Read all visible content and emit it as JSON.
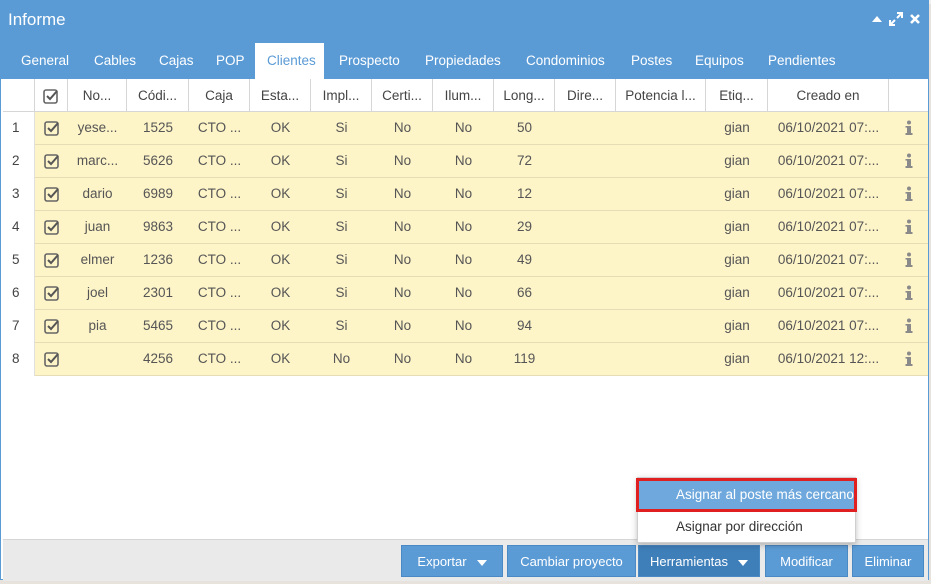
{
  "window": {
    "title": "Informe"
  },
  "tabs": [
    {
      "label": "General",
      "active": false
    },
    {
      "label": "Cables",
      "active": false
    },
    {
      "label": "Cajas",
      "active": false
    },
    {
      "label": "POP",
      "active": false
    },
    {
      "label": "Clientes",
      "active": true
    },
    {
      "label": "Prospecto",
      "active": false
    },
    {
      "label": "Propiedades",
      "active": false
    },
    {
      "label": "Condominios",
      "active": false
    },
    {
      "label": "Postes",
      "active": false
    },
    {
      "label": "Equipos",
      "active": false
    },
    {
      "label": "Pendientes",
      "active": false
    }
  ],
  "table": {
    "columns": [
      "",
      "",
      "No...",
      "Códi...",
      "Caja",
      "Esta...",
      "Impl...",
      "Certi...",
      "Ilum...",
      "Long...",
      "Dire...",
      "Potencia l...",
      "Etiq...",
      "Creado en",
      ""
    ],
    "rows": [
      {
        "n": "1",
        "nombre": "yese...",
        "codigo": "1525",
        "caja": "CTO ...",
        "estado": "OK",
        "impl": "Si",
        "cert": "No",
        "ilum": "No",
        "long": "50",
        "dir": "",
        "pot": "",
        "etiq": "gian",
        "creado": "06/10/2021 07:..."
      },
      {
        "n": "2",
        "nombre": "marc...",
        "codigo": "5626",
        "caja": "CTO ...",
        "estado": "OK",
        "impl": "Si",
        "cert": "No",
        "ilum": "No",
        "long": "72",
        "dir": "",
        "pot": "",
        "etiq": "gian",
        "creado": "06/10/2021 07:..."
      },
      {
        "n": "3",
        "nombre": "dario",
        "codigo": "6989",
        "caja": "CTO ...",
        "estado": "OK",
        "impl": "Si",
        "cert": "No",
        "ilum": "No",
        "long": "12",
        "dir": "",
        "pot": "",
        "etiq": "gian",
        "creado": "06/10/2021 07:..."
      },
      {
        "n": "4",
        "nombre": "juan",
        "codigo": "9863",
        "caja": "CTO ...",
        "estado": "OK",
        "impl": "Si",
        "cert": "No",
        "ilum": "No",
        "long": "29",
        "dir": "",
        "pot": "",
        "etiq": "gian",
        "creado": "06/10/2021 07:..."
      },
      {
        "n": "5",
        "nombre": "elmer",
        "codigo": "1236",
        "caja": "CTO ...",
        "estado": "OK",
        "impl": "Si",
        "cert": "No",
        "ilum": "No",
        "long": "49",
        "dir": "",
        "pot": "",
        "etiq": "gian",
        "creado": "06/10/2021 07:..."
      },
      {
        "n": "6",
        "nombre": "joel",
        "codigo": "2301",
        "caja": "CTO ...",
        "estado": "OK",
        "impl": "Si",
        "cert": "No",
        "ilum": "No",
        "long": "66",
        "dir": "",
        "pot": "",
        "etiq": "gian",
        "creado": "06/10/2021 07:..."
      },
      {
        "n": "7",
        "nombre": "pia",
        "codigo": "5465",
        "caja": "CTO ...",
        "estado": "OK",
        "impl": "Si",
        "cert": "No",
        "ilum": "No",
        "long": "94",
        "dir": "",
        "pot": "",
        "etiq": "gian",
        "creado": "06/10/2021 07:..."
      },
      {
        "n": "8",
        "nombre": "",
        "codigo": "4256",
        "caja": "CTO ...",
        "estado": "OK",
        "impl": "No",
        "cert": "No",
        "ilum": "No",
        "long": "119",
        "dir": "",
        "pot": "",
        "etiq": "gian",
        "creado": "06/10/2021 12:..."
      }
    ]
  },
  "footer": {
    "exportar": "Exportar",
    "cambiar": "Cambiar proyecto",
    "herramientas": "Herramientas",
    "modificar": "Modificar",
    "eliminar": "Eliminar"
  },
  "menu": {
    "items": [
      "Asignar al poste más cercano",
      "Asignar por dirección"
    ]
  },
  "colors": {
    "accent": "#5b9bd5",
    "row_bg": "#fdf4c8",
    "highlight_border": "#e02020"
  },
  "icons": {
    "check": "checkbox-checked-icon",
    "info": "info-icon",
    "collapse": "triangle-up-icon",
    "expand": "expand-arrows-icon",
    "close": "close-icon",
    "caret": "caret-down-icon"
  }
}
